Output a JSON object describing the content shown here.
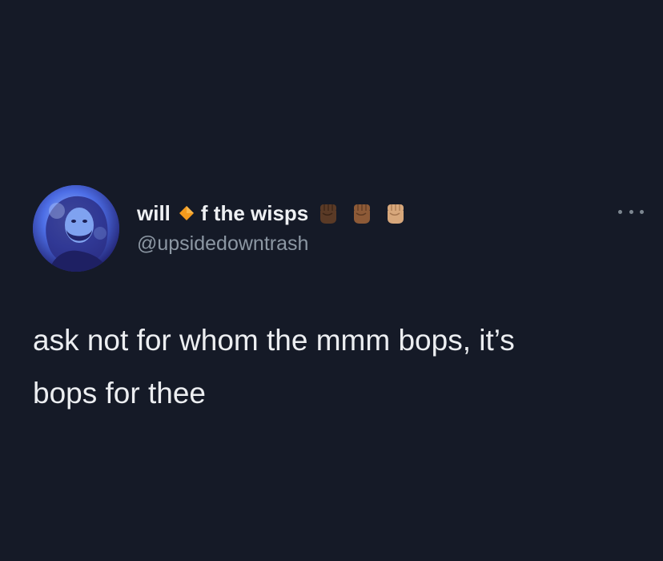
{
  "tweet": {
    "author": {
      "name_part1": "will",
      "name_part2": "f the wisps",
      "handle": "@upsidedowntrash"
    },
    "text_line1": "ask not for whom the mmm bops, it’s",
    "text_line2": "bops for thee"
  },
  "icons": {
    "diamond": "orange-diamond-icon",
    "fists": [
      "raised-fist-dark-skin-icon",
      "raised-fist-medium-dark-skin-icon",
      "raised-fist-light-skin-icon"
    ],
    "more": "more-options-icon"
  },
  "colors": {
    "background": "#151a27",
    "name": "#eef0f3",
    "handle": "#8c97a3",
    "diamond": "#f39a1d",
    "fist_dark": "#5a3a26",
    "fist_medium_dark": "#8d5a37",
    "fist_light": "#d7a77b"
  }
}
